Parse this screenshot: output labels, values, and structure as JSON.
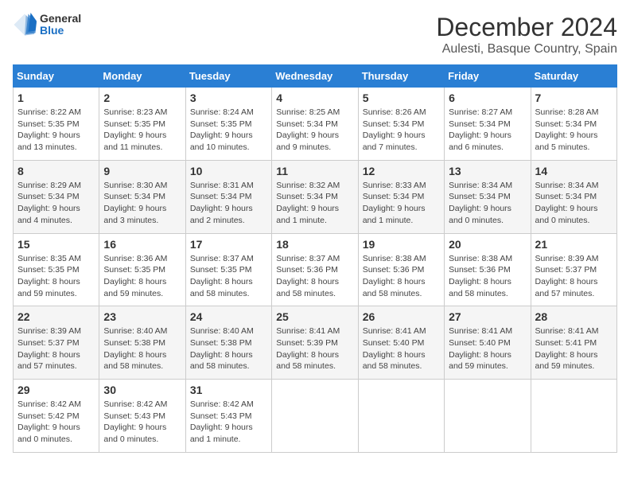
{
  "logo": {
    "general": "General",
    "blue": "Blue"
  },
  "header": {
    "title": "December 2024",
    "subtitle": "Aulesti, Basque Country, Spain"
  },
  "weekdays": [
    "Sunday",
    "Monday",
    "Tuesday",
    "Wednesday",
    "Thursday",
    "Friday",
    "Saturday"
  ],
  "weeks": [
    [
      {
        "day": "1",
        "info": "Sunrise: 8:22 AM\nSunset: 5:35 PM\nDaylight: 9 hours\nand 13 minutes."
      },
      {
        "day": "2",
        "info": "Sunrise: 8:23 AM\nSunset: 5:35 PM\nDaylight: 9 hours\nand 11 minutes."
      },
      {
        "day": "3",
        "info": "Sunrise: 8:24 AM\nSunset: 5:35 PM\nDaylight: 9 hours\nand 10 minutes."
      },
      {
        "day": "4",
        "info": "Sunrise: 8:25 AM\nSunset: 5:34 PM\nDaylight: 9 hours\nand 9 minutes."
      },
      {
        "day": "5",
        "info": "Sunrise: 8:26 AM\nSunset: 5:34 PM\nDaylight: 9 hours\nand 7 minutes."
      },
      {
        "day": "6",
        "info": "Sunrise: 8:27 AM\nSunset: 5:34 PM\nDaylight: 9 hours\nand 6 minutes."
      },
      {
        "day": "7",
        "info": "Sunrise: 8:28 AM\nSunset: 5:34 PM\nDaylight: 9 hours\nand 5 minutes."
      }
    ],
    [
      {
        "day": "8",
        "info": "Sunrise: 8:29 AM\nSunset: 5:34 PM\nDaylight: 9 hours\nand 4 minutes."
      },
      {
        "day": "9",
        "info": "Sunrise: 8:30 AM\nSunset: 5:34 PM\nDaylight: 9 hours\nand 3 minutes."
      },
      {
        "day": "10",
        "info": "Sunrise: 8:31 AM\nSunset: 5:34 PM\nDaylight: 9 hours\nand 2 minutes."
      },
      {
        "day": "11",
        "info": "Sunrise: 8:32 AM\nSunset: 5:34 PM\nDaylight: 9 hours\nand 1 minute."
      },
      {
        "day": "12",
        "info": "Sunrise: 8:33 AM\nSunset: 5:34 PM\nDaylight: 9 hours\nand 1 minute."
      },
      {
        "day": "13",
        "info": "Sunrise: 8:34 AM\nSunset: 5:34 PM\nDaylight: 9 hours\nand 0 minutes."
      },
      {
        "day": "14",
        "info": "Sunrise: 8:34 AM\nSunset: 5:34 PM\nDaylight: 9 hours\nand 0 minutes."
      }
    ],
    [
      {
        "day": "15",
        "info": "Sunrise: 8:35 AM\nSunset: 5:35 PM\nDaylight: 8 hours\nand 59 minutes."
      },
      {
        "day": "16",
        "info": "Sunrise: 8:36 AM\nSunset: 5:35 PM\nDaylight: 8 hours\nand 59 minutes."
      },
      {
        "day": "17",
        "info": "Sunrise: 8:37 AM\nSunset: 5:35 PM\nDaylight: 8 hours\nand 58 minutes."
      },
      {
        "day": "18",
        "info": "Sunrise: 8:37 AM\nSunset: 5:36 PM\nDaylight: 8 hours\nand 58 minutes."
      },
      {
        "day": "19",
        "info": "Sunrise: 8:38 AM\nSunset: 5:36 PM\nDaylight: 8 hours\nand 58 minutes."
      },
      {
        "day": "20",
        "info": "Sunrise: 8:38 AM\nSunset: 5:36 PM\nDaylight: 8 hours\nand 58 minutes."
      },
      {
        "day": "21",
        "info": "Sunrise: 8:39 AM\nSunset: 5:37 PM\nDaylight: 8 hours\nand 57 minutes."
      }
    ],
    [
      {
        "day": "22",
        "info": "Sunrise: 8:39 AM\nSunset: 5:37 PM\nDaylight: 8 hours\nand 57 minutes."
      },
      {
        "day": "23",
        "info": "Sunrise: 8:40 AM\nSunset: 5:38 PM\nDaylight: 8 hours\nand 58 minutes."
      },
      {
        "day": "24",
        "info": "Sunrise: 8:40 AM\nSunset: 5:38 PM\nDaylight: 8 hours\nand 58 minutes."
      },
      {
        "day": "25",
        "info": "Sunrise: 8:41 AM\nSunset: 5:39 PM\nDaylight: 8 hours\nand 58 minutes."
      },
      {
        "day": "26",
        "info": "Sunrise: 8:41 AM\nSunset: 5:40 PM\nDaylight: 8 hours\nand 58 minutes."
      },
      {
        "day": "27",
        "info": "Sunrise: 8:41 AM\nSunset: 5:40 PM\nDaylight: 8 hours\nand 59 minutes."
      },
      {
        "day": "28",
        "info": "Sunrise: 8:41 AM\nSunset: 5:41 PM\nDaylight: 8 hours\nand 59 minutes."
      }
    ],
    [
      {
        "day": "29",
        "info": "Sunrise: 8:42 AM\nSunset: 5:42 PM\nDaylight: 9 hours\nand 0 minutes."
      },
      {
        "day": "30",
        "info": "Sunrise: 8:42 AM\nSunset: 5:43 PM\nDaylight: 9 hours\nand 0 minutes."
      },
      {
        "day": "31",
        "info": "Sunrise: 8:42 AM\nSunset: 5:43 PM\nDaylight: 9 hours\nand 1 minute."
      },
      null,
      null,
      null,
      null
    ]
  ]
}
